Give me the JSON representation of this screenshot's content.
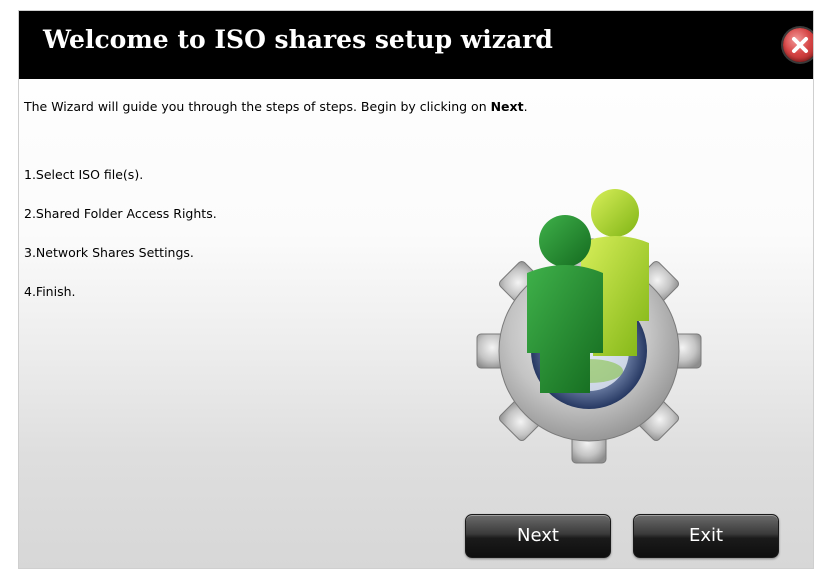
{
  "window": {
    "title": "Welcome to ISO shares setup wizard",
    "close_icon": "close-icon"
  },
  "intro": {
    "text_before": "The Wizard will guide you through the steps of steps. Begin by clicking on ",
    "text_bold": "Next",
    "text_after": "."
  },
  "steps": [
    "1.Select ISO file(s).",
    "2.Shared Folder Access Rights.",
    "3.Network Shares Settings.",
    "4.Finish."
  ],
  "illustration": {
    "icon": "users-gear-icon",
    "colors": {
      "gear": "#c9c9c9",
      "front_user": "#1f8a2a",
      "back_user": "#9fce1a",
      "ring": "#3b4f7a"
    }
  },
  "buttons": {
    "next_label": "Next",
    "exit_label": "Exit"
  },
  "colors": {
    "title_bar": "#000000",
    "close_button": "#d64545",
    "button": "#2a2a2a"
  }
}
